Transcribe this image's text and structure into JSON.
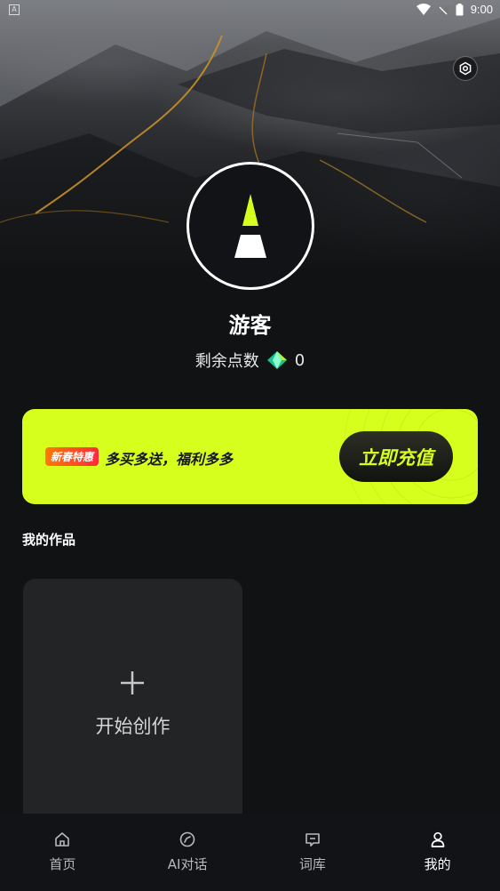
{
  "status_bar": {
    "time": "9:00",
    "notification_icon": "A"
  },
  "profile": {
    "name": "游客",
    "points_label": "剩余点数",
    "points_value": "0"
  },
  "promo": {
    "tag": "新春特惠",
    "text": "多买多送，福利多多",
    "button": "立即充值"
  },
  "works": {
    "section_title": "我的作品",
    "create_label": "开始创作"
  },
  "tabs": [
    {
      "label": "首页",
      "icon": "home-icon"
    },
    {
      "label": "AI对话",
      "icon": "compass-icon"
    },
    {
      "label": "词库",
      "icon": "chat-icon"
    },
    {
      "label": "我的",
      "icon": "user-icon"
    }
  ],
  "colors": {
    "accent": "#d7ff1e",
    "background": "#111214",
    "card": "#232426"
  }
}
